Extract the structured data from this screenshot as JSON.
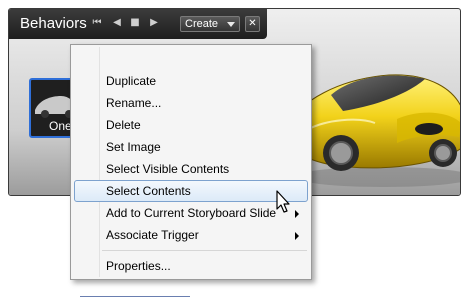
{
  "panel": {
    "title": "Behaviors",
    "nav_icons": [
      "skip-to-start-icon",
      "step-back-icon",
      "stop-icon",
      "play-icon"
    ],
    "create_label": "Create",
    "close_glyph": "✕",
    "thumbnail_label": "One"
  },
  "menu": {
    "items": [
      {
        "label": "Duplicate"
      },
      {
        "label": "Rename..."
      },
      {
        "label": "Delete"
      },
      {
        "label": "Set Image"
      },
      {
        "label": "Select Visible Contents"
      },
      {
        "label": "Select Contents",
        "highlighted": true
      },
      {
        "label": "Add to Current Storyboard Slide",
        "submenu": true
      },
      {
        "label": "Associate Trigger",
        "submenu": true
      },
      {
        "label": "Properties..."
      }
    ]
  },
  "colors": {
    "highlight_border": "#7da2ce",
    "selection_border": "#2f6fd8",
    "car_yellow": "#f2d21a"
  }
}
